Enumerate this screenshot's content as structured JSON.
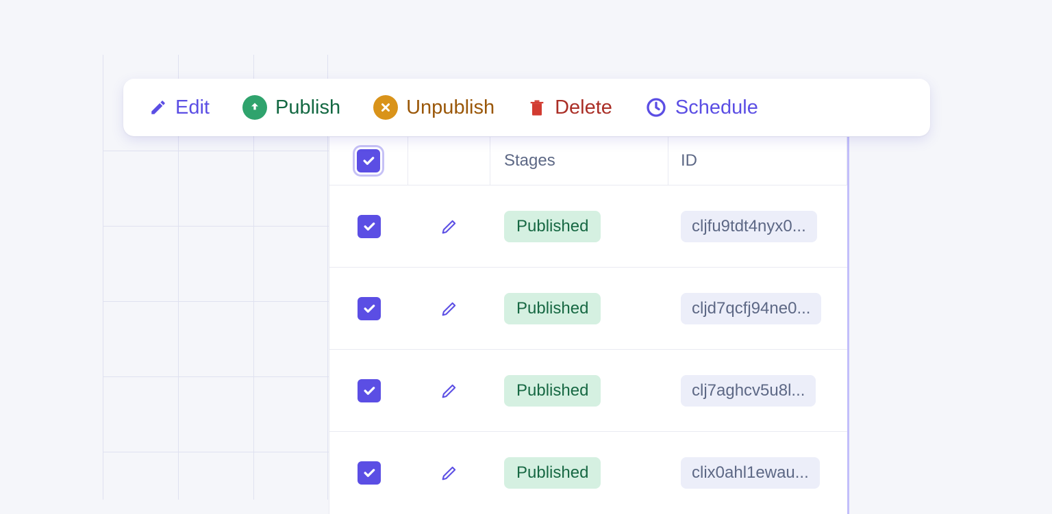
{
  "toolbar": {
    "edit": "Edit",
    "publish": "Publish",
    "unpublish": "Unpublish",
    "delete": "Delete",
    "schedule": "Schedule"
  },
  "table": {
    "columns": {
      "stages": "Stages",
      "id": "ID"
    },
    "rows": [
      {
        "stage": "Published",
        "id": "cljfu9tdt4nyx0..."
      },
      {
        "stage": "Published",
        "id": "cljd7qcfj94ne0..."
      },
      {
        "stage": "Published",
        "id": "clj7aghcv5u8l..."
      },
      {
        "stage": "Published",
        "id": "clix0ahl1ewau..."
      }
    ]
  },
  "colors": {
    "primary": "#5B4EE4",
    "green": "#2fa36d",
    "orange": "#d9931a",
    "red": "#aa2e26"
  }
}
